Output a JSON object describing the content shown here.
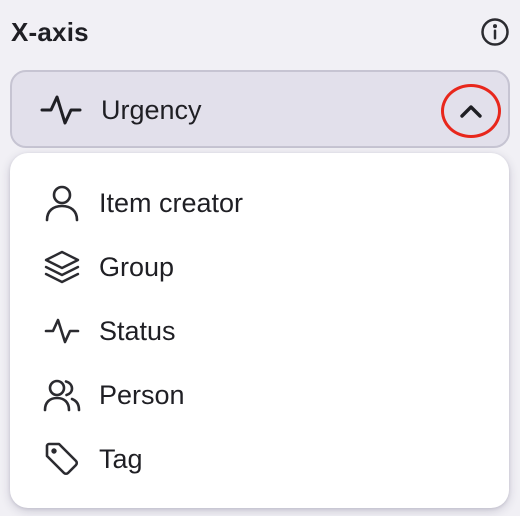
{
  "header": {
    "title": "X-axis",
    "info_icon": "info-icon"
  },
  "select": {
    "icon": "activity-icon",
    "value": "Urgency",
    "chevron": "chevron-up-icon"
  },
  "menu": {
    "items": [
      {
        "label": "Item creator",
        "icon": "user-icon"
      },
      {
        "label": "Group",
        "icon": "layers-icon"
      },
      {
        "label": "Status",
        "icon": "activity-icon"
      },
      {
        "label": "Person",
        "icon": "users-icon"
      },
      {
        "label": "Tag",
        "icon": "tag-icon"
      }
    ]
  },
  "colors": {
    "highlight_ring": "#e8271c",
    "select_bg": "#e2e0eb",
    "page_bg": "#f1f0f5"
  }
}
